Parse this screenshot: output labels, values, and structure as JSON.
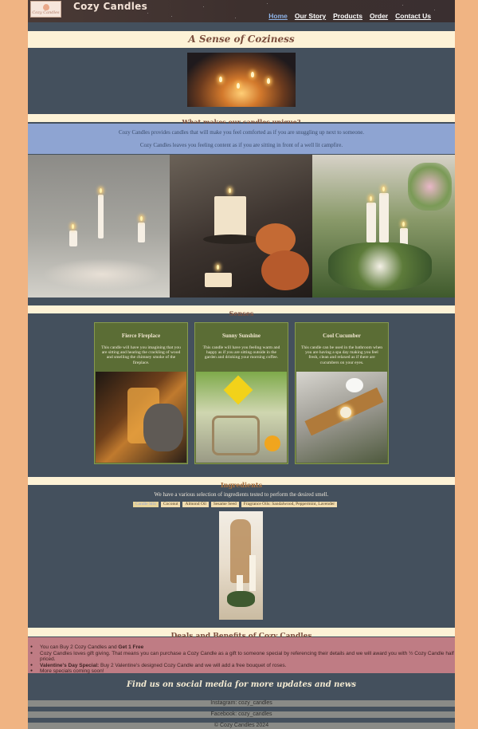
{
  "header": {
    "logo_text": "Cozy Candles",
    "brand": "Cozy Candles",
    "nav": [
      "Home",
      "Our Story",
      "Products",
      "Order",
      "Contact Us"
    ],
    "active_nav": "Home"
  },
  "hero": {
    "title": "A Sense of Coziness",
    "image_icon": "tealight-candles-image"
  },
  "unique": {
    "title": "What makes our candles unique?",
    "lines": [
      "Cozy Candles provides candles that will make you feel comforted as if you are snuggling up next to someone.",
      "Cozy Candles leaves you feeling content as if you are sitting in front of a well lit campfire."
    ]
  },
  "senses": {
    "title": "Senses",
    "cards": [
      {
        "title": "Fierce Fireplace",
        "text": "This candle will have you imagining that you are sitting and hearing the crackling of wood and smelling the chimney smoke of the fireplace."
      },
      {
        "title": "Sunny Sunshine",
        "text": "This candle will have you feeling warm and happy as if you are sitting outside in the garden and drinking your morning coffee."
      },
      {
        "title": "Cool Cucumber",
        "text": "This candle can be used in the bathroom when you are having a spa day making you feel fresh, clean and relaxed as if there are cucumbers on your eyes."
      }
    ]
  },
  "ingredients": {
    "title": "Ingredients",
    "subtitle": "We have a various selection of ingredients tested to perform the desired smell.",
    "tags": [
      "Candle Stix",
      "Coconut",
      "Almond Oil",
      "Sesame Seed",
      "Fragrance Oils: Sandalwood, Peppermint, Lavender"
    ]
  },
  "deals": {
    "title": "Deals and Benefits of Cozy Candles",
    "items": [
      {
        "pre": "You can Buy 2 Cozy Candles and ",
        "bold": "Get 1 Free",
        "post": ""
      },
      {
        "pre": "Cozy Candles loves gift giving. That means you can purchase a Cozy Candle as a gift to someone special by referencing their details and we will award you with ½ Cozy Candle half priced.",
        "bold": "",
        "post": ""
      },
      {
        "pre": "",
        "bold": "Valentine's Day Special:",
        "post": " Buy 2 Valentine's designed Cozy Candle and we will add a free bouquet of roses."
      },
      {
        "pre": "More specials coming soon!",
        "bold": "",
        "post": ""
      }
    ]
  },
  "social": {
    "title": "Find us on social media for more updates and news",
    "instagram": "Instagram: cozy_candles",
    "facebook": "Facebook: cozy_candles",
    "copyright": "© Cozy Candles 2024"
  }
}
